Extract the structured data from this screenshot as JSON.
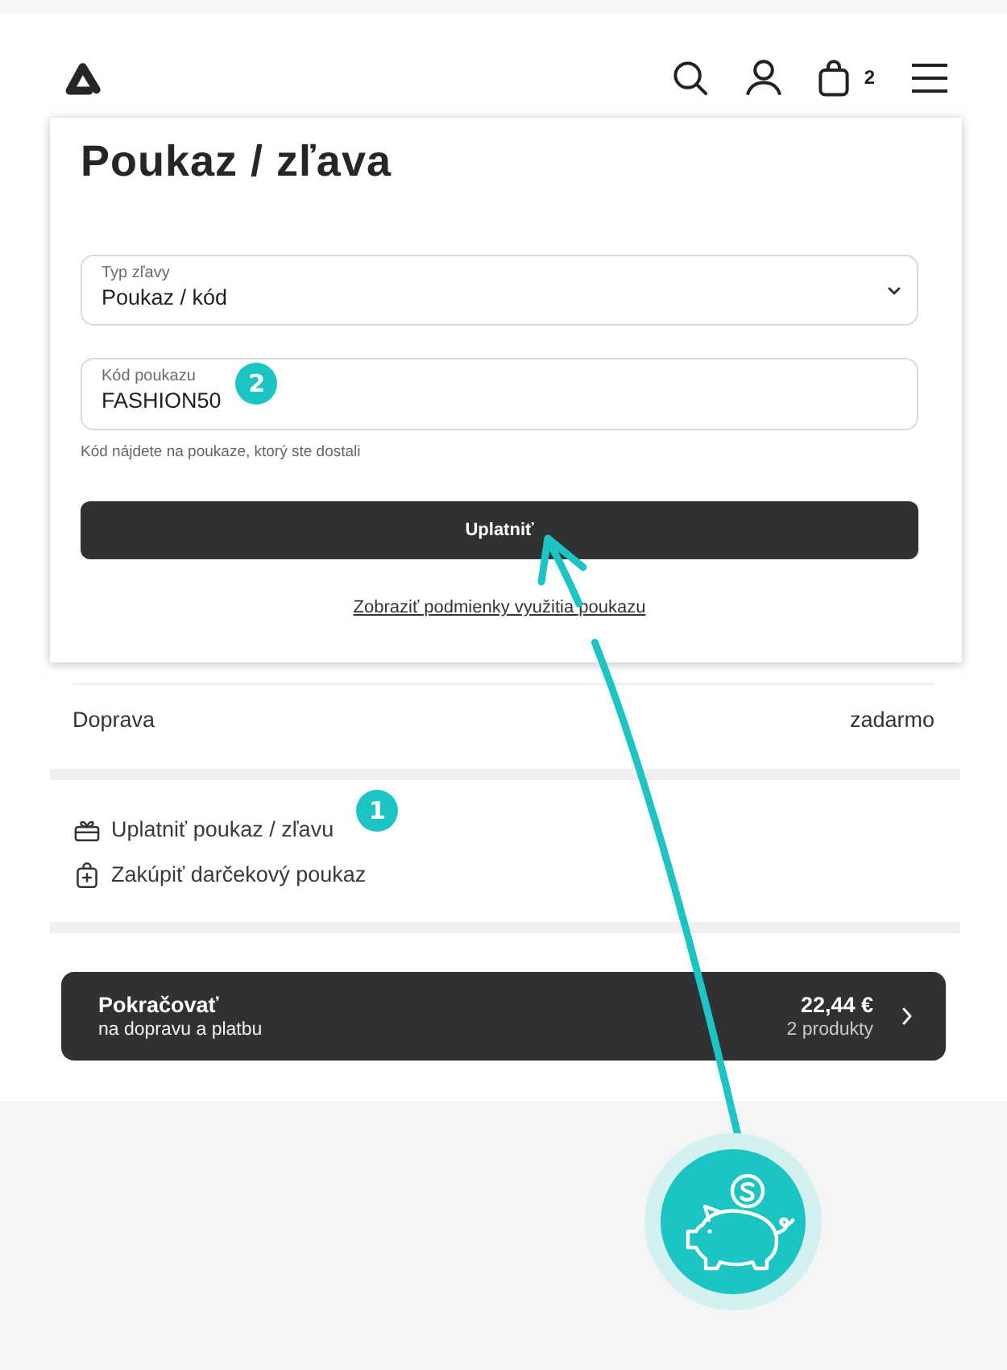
{
  "header": {
    "cart_count": "2"
  },
  "voucher_panel": {
    "title": "Poukaz / zľava",
    "fields": [
      {
        "kind": "select",
        "label": "Typ zľavy",
        "value": "Poukaz / kód"
      },
      {
        "kind": "text",
        "label": "Kód poukazu",
        "value": "FASHION50",
        "marker": "2"
      }
    ],
    "hint": "Kód nájdete na poukaze, ktorý ste dostali",
    "apply_button": "Uplatniť",
    "terms_link": "Zobraziť podmienky využitia poukazu"
  },
  "shipping": {
    "label": "Doprava",
    "value": "zadarmo"
  },
  "actions": [
    {
      "kind": "redeem",
      "label": "Uplatniť poukaz / zľavu",
      "marker": "1"
    },
    {
      "kind": "purchase",
      "label": "Zakúpiť darčekový poukaz"
    }
  ],
  "continue_button": {
    "title": "Pokračovať",
    "subtitle": "na dopravu a platbu",
    "price": "22,44 €",
    "count": "2 produkty"
  }
}
